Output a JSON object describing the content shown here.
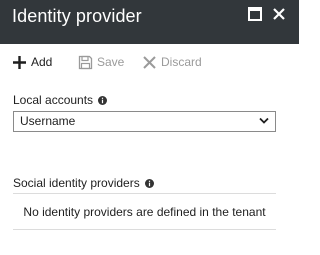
{
  "header": {
    "title": "Identity provider",
    "maximize_icon": "maximize-icon",
    "close_icon": "close-icon",
    "bg_color": "#32373b"
  },
  "toolbar": {
    "add_label": "Add",
    "save_label": "Save",
    "discard_label": "Discard",
    "disabled_color": "#9a9a9a"
  },
  "local_accounts": {
    "label": "Local accounts",
    "selected": "Username"
  },
  "social_providers": {
    "label": "Social identity providers",
    "empty_message": "No identity providers are defined in the tenant"
  }
}
